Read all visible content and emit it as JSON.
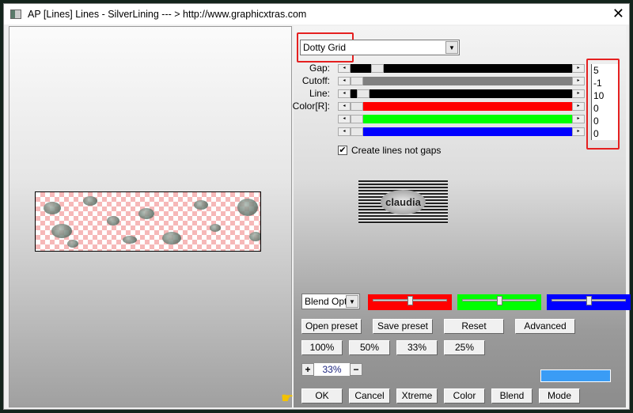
{
  "window": {
    "title": "AP [Lines]  Lines - SilverLining    --- > http://www.graphicxtras.com",
    "close": "✕"
  },
  "preset_select": {
    "value": "Dotty Grid"
  },
  "controls": [
    {
      "label": "Gap:",
      "value": "5",
      "color": "#000000",
      "thumb": 0.1
    },
    {
      "label": "Cutoff:",
      "value": "-1",
      "color": "#808080",
      "thumb": 0.0
    },
    {
      "label": "Line:",
      "value": "10",
      "color": "#000000",
      "thumb": 0.03
    },
    {
      "label": "Color[R]:",
      "value": "0",
      "color": "#ff0000",
      "thumb": 0.0
    },
    {
      "label": "",
      "value": "0",
      "color": "#00ff00",
      "thumb": 0.0
    },
    {
      "label": "",
      "value": "0",
      "color": "#0000ff",
      "thumb": 0.0
    }
  ],
  "checkbox": {
    "label": "Create lines not gaps",
    "checked": true
  },
  "logo_text": "claudia",
  "blend_select": {
    "value": "Blend Opti"
  },
  "color_sliders": [
    {
      "color": "#ff0000",
      "level": 0.5
    },
    {
      "color": "#00ff00",
      "level": 0.5
    },
    {
      "color": "#0000ff",
      "level": 0.5
    }
  ],
  "buttons": {
    "open_preset": "Open preset",
    "save_preset": "Save preset",
    "reset": "Reset",
    "advanced": "Advanced",
    "z100": "100%",
    "z50": "50%",
    "z33": "33%",
    "z25": "25%",
    "ok": "OK",
    "cancel": "Cancel",
    "xtreme": "Xtreme",
    "color": "Color",
    "blend": "Blend",
    "mode": "Mode"
  },
  "zoom": {
    "plus": "+",
    "value": "33%",
    "minus": "−"
  },
  "swatch_color": "#3a9cf5"
}
